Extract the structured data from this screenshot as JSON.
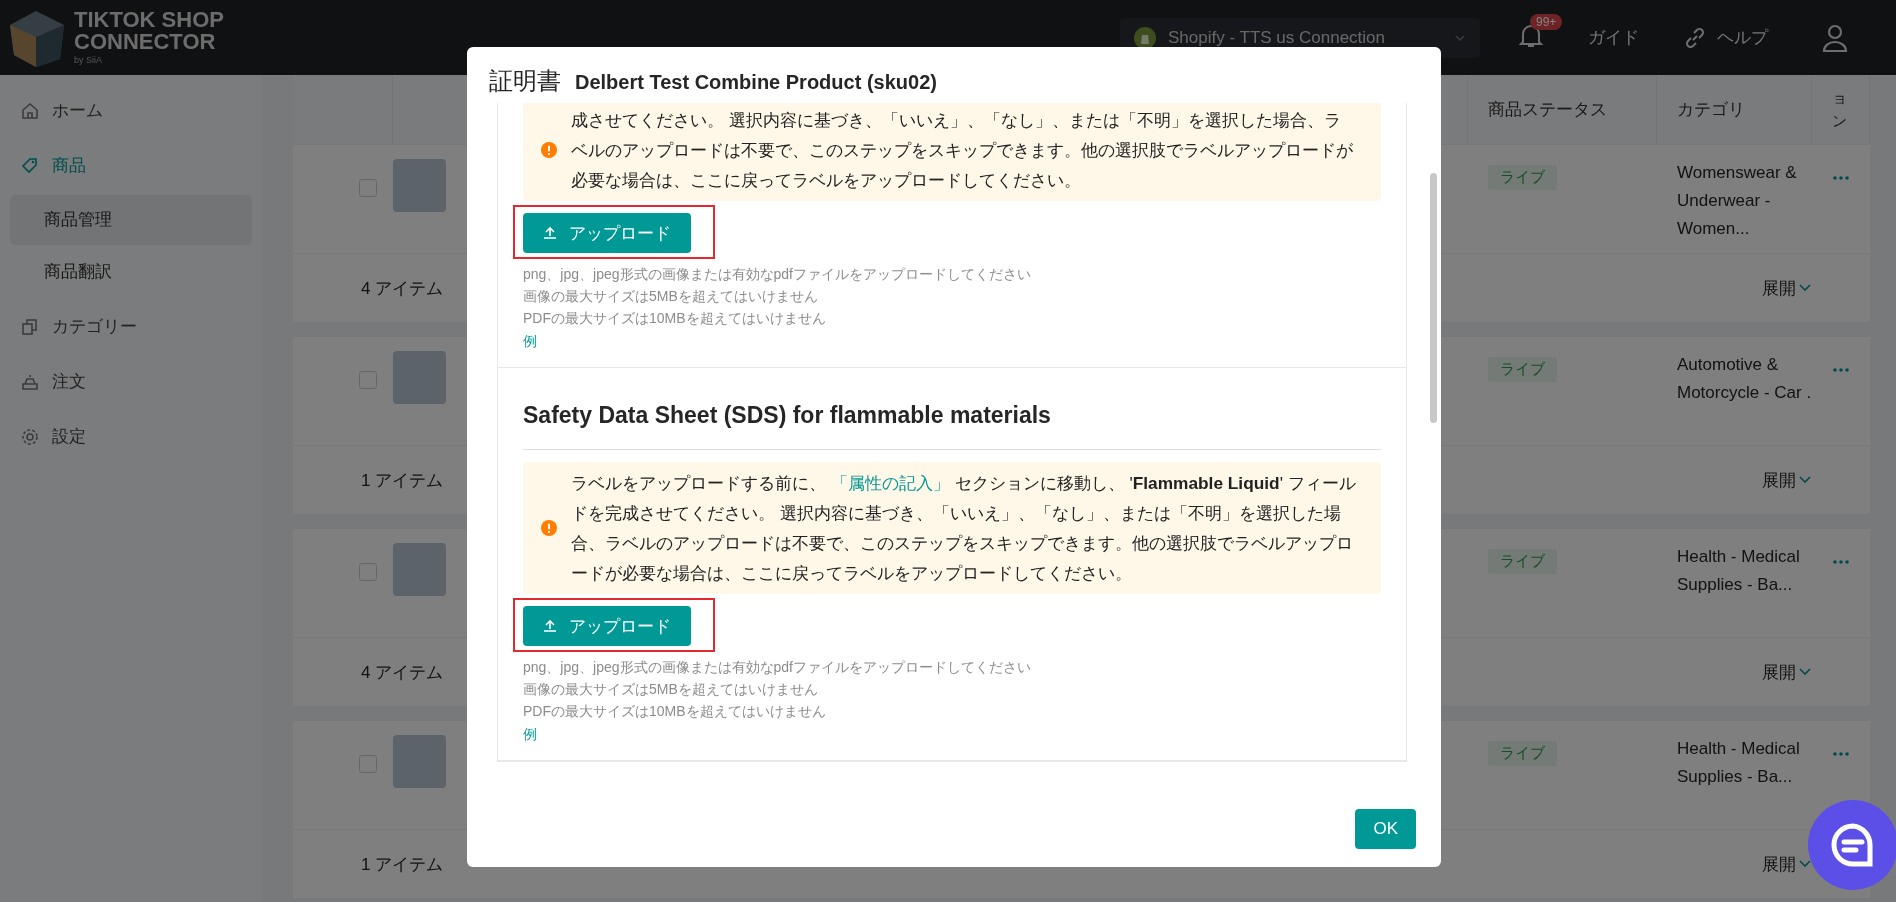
{
  "header": {
    "logo": {
      "line_1": "TIKTOK SHOP",
      "line_2": "CONNECTOR",
      "tagline": "by SiiA"
    },
    "connection": "Shopify - TTS us Connection",
    "notifications_badge": "99+",
    "guide": "ガイド",
    "help": "ヘルプ"
  },
  "sidebar": {
    "items": [
      {
        "label": "ホーム",
        "expanded": false
      },
      {
        "label": "商品",
        "expanded": true,
        "children": [
          {
            "label": "商品管理",
            "selected": true
          },
          {
            "label": "商品翻訳",
            "selected": false
          }
        ]
      },
      {
        "label": "カテゴリー",
        "expanded": false
      },
      {
        "label": "注文",
        "expanded": false
      },
      {
        "label": "設定",
        "expanded": false
      }
    ]
  },
  "table": {
    "columns": [
      "商品ステータス",
      "カテゴリ",
      "ョン"
    ],
    "rows": [
      {
        "checked": false,
        "status": "ライブ",
        "category": "Womenswear & Underwear - Women...",
        "item_count": "4 アイテム",
        "expand": "展開"
      },
      {
        "checked": false,
        "status": "ライブ",
        "category": "Automotive & Motorcycle - Car .",
        "item_count": "1 アイテム",
        "expand": "展開"
      },
      {
        "checked": false,
        "status": "ライブ",
        "category": "Health - Medical Supplies - Ba...",
        "item_count": "4 アイテム",
        "expand": "展開"
      },
      {
        "checked": false,
        "status": "ライブ",
        "category": "Health - Medical Supplies - Ba...",
        "item_count": "1 アイテム",
        "expand": "展開"
      }
    ]
  },
  "modal": {
    "title": "証明書",
    "product": "Delbert Test Combine Product (sku02)",
    "sections": [
      {
        "notice": {
          "text": "成させてください。 選択内容に基づき、「いいえ」、「なし」、または「不明」を選択した場合、ラベルのアップロードは不要で、このステップをスキップできます。他の選択肢でラベルアップロードが必要な場合は、ここに戻ってラベルをアップロードしてください。"
        },
        "upload": {
          "label": "アップロード",
          "highlighted": true
        },
        "hints": [
          "png、jpg、jpeg形式の画像または有効なpdfファイルをアップロードしてください",
          "画像の最大サイズは5MBを超えてはいけません",
          "PDFの最大サイズは10MBを超えてはいけません"
        ],
        "example": "例"
      },
      {
        "title": "Safety Data Sheet (SDS) for flammable materials",
        "notice": {
          "text": "ラベルをアップロードする前に、 ",
          "link": "「属性の記入」",
          "after": " セクションに移動し、 '**Flammable Liquid**' フィールドを完成させてください。 選択内容に基づき、「いいえ」、「なし」、または「不明」を選択した場合、ラベルのアップロードは不要で、このステップをスキップできます。他の選択肢でラベルアップロードが必要な場合は、ここに戻ってラベルをアップロードしてください。"
        },
        "upload": {
          "label": "アップロード",
          "highlighted": true
        },
        "hints": [
          "png、jpg、jpeg形式の画像または有効なpdfファイルをアップロードしてください",
          "画像の最大サイズは5MBを超えてはいけません",
          "PDFの最大サイズは10MBを超えてはいけません"
        ],
        "example": "例"
      }
    ],
    "ok": "OK"
  }
}
